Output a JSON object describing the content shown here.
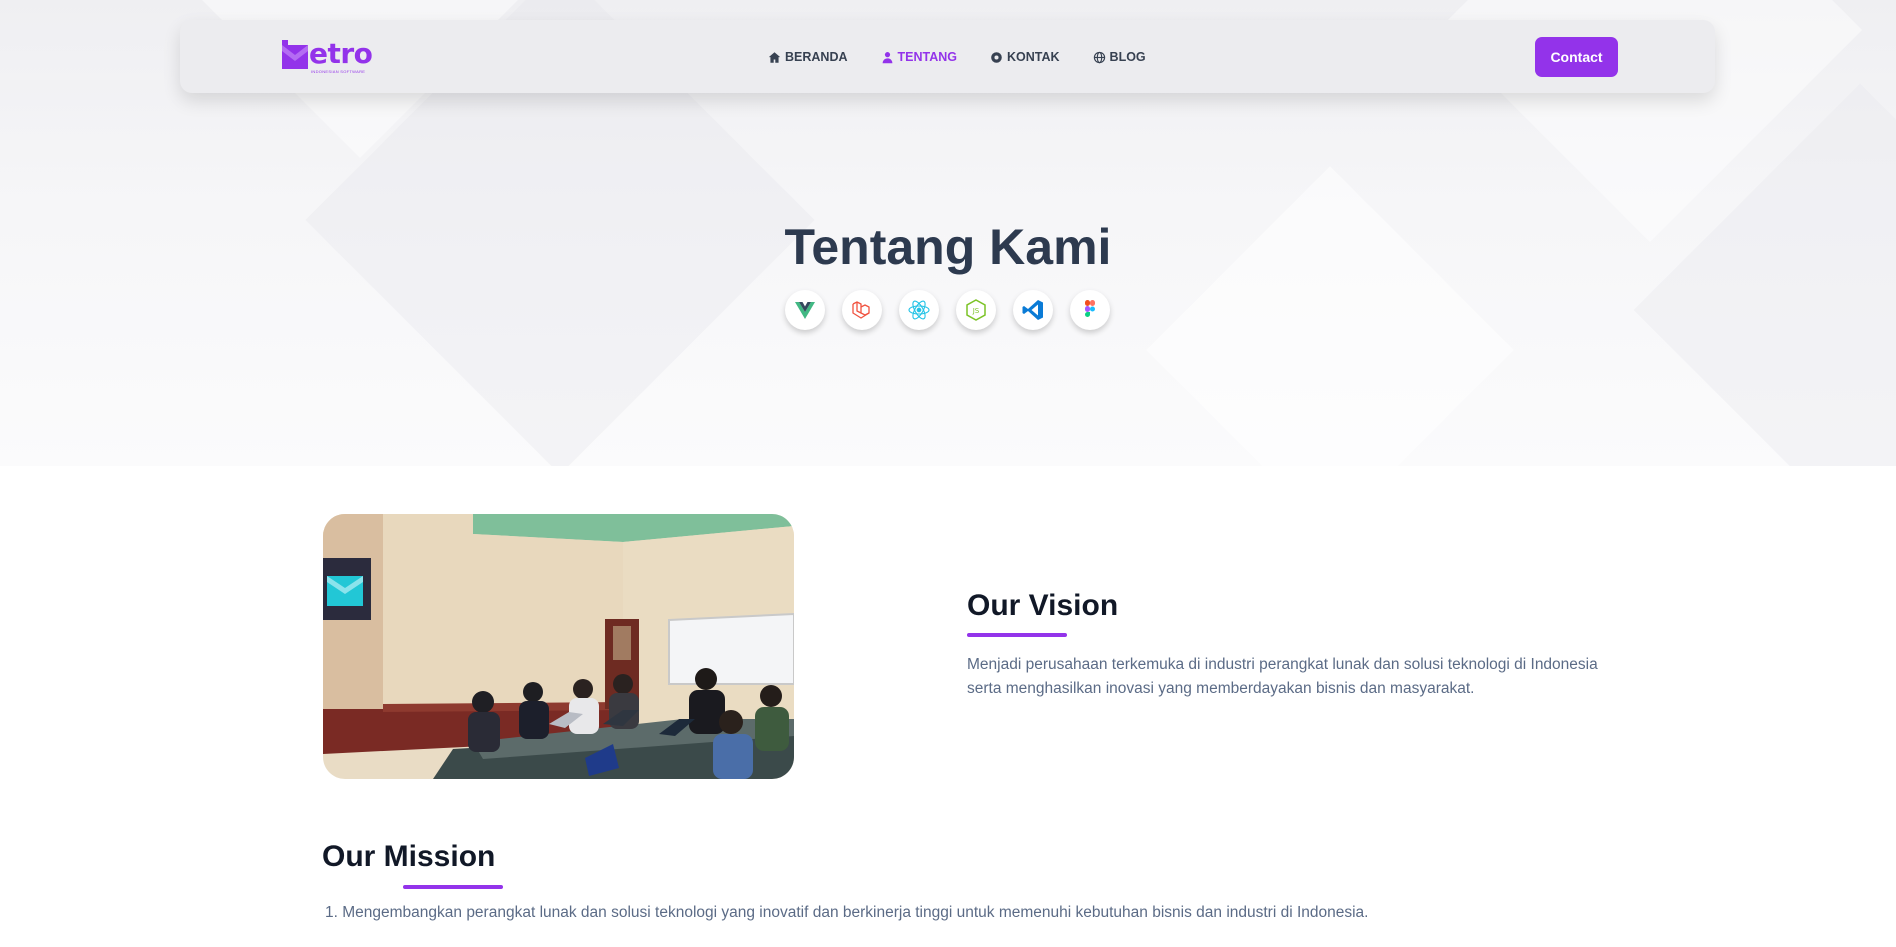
{
  "brand": {
    "logo_text": "etro",
    "logo_subtitle": "INDONESIAN SOFTWARE"
  },
  "nav": {
    "items": [
      {
        "label": "BERANDA",
        "icon": "home-icon",
        "active": false
      },
      {
        "label": "TENTANG",
        "icon": "user-icon",
        "active": true
      },
      {
        "label": "KONTAK",
        "icon": "contact-icon",
        "active": false
      },
      {
        "label": "BLOG",
        "icon": "globe-icon",
        "active": false
      }
    ],
    "contact_button": "Contact"
  },
  "hero": {
    "title": "Tentang Kami",
    "tech_icons": [
      "vue-icon",
      "laravel-icon",
      "react-icon",
      "nodejs-icon",
      "vscode-icon",
      "figma-icon"
    ]
  },
  "vision": {
    "title": "Our Vision",
    "text": "Menjadi perusahaan terkemuka di industri perangkat lunak dan solusi teknologi di Indonesia serta menghasilkan inovasi yang memberdayakan bisnis dan masyarakat."
  },
  "mission": {
    "title": "Our Mission",
    "items": [
      "1. Mengembangkan perangkat lunak dan solusi teknologi yang inovatif dan berkinerja tinggi untuk memenuhi kebutuhan bisnis dan industri di Indonesia."
    ]
  },
  "colors": {
    "accent": "#9333ea",
    "heading": "#2d3a4f",
    "body_text": "#5b6b86"
  }
}
